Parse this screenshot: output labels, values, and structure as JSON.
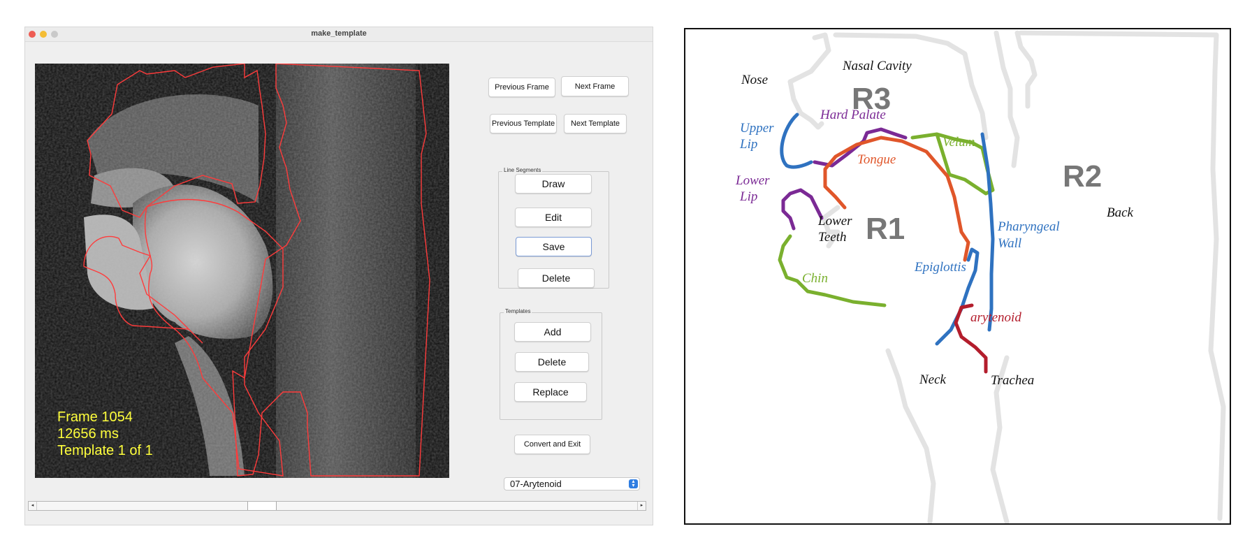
{
  "window": {
    "title": "make_template",
    "traffic_lights": [
      "#ee5c53",
      "#f4bd35",
      "#c9c9c9"
    ]
  },
  "overlay": {
    "frame": "Frame 1054",
    "time": "12656 ms",
    "template": "Template 1 of 1",
    "color": "#ffff3c"
  },
  "buttons": {
    "previous_frame": "Previous Frame",
    "next_frame": "Next Frame",
    "previous_template": "Previous Template",
    "next_template": "Next Template",
    "convert_exit": "Convert and Exit"
  },
  "line_segments": {
    "label": "Line Segments",
    "draw": "Draw",
    "edit": "Edit",
    "save": "Save",
    "delete": "Delete"
  },
  "templates": {
    "label": "Templates",
    "add": "Add",
    "delete": "Delete",
    "replace": "Replace"
  },
  "dropdown": {
    "selected": "07-Arytenoid",
    "icon": "updown-chevron-icon"
  },
  "scrollbar": {
    "left_arrow": "◂",
    "right_arrow": "▸"
  },
  "diagram": {
    "regions": [
      "R1",
      "R2",
      "R3"
    ],
    "labels": {
      "nasal_cavity": "Nasal Cavity",
      "nose": "Nose",
      "hard_palate": "Hard Palate",
      "upper_lip_1": "Upper",
      "upper_lip_2": "Lip",
      "velum": "Velum",
      "tongue": "Tongue",
      "lower_lip_1": "Lower",
      "lower_lip_2": "Lip",
      "lower_teeth_1": "Lower",
      "lower_teeth_2": "Teeth",
      "pharyngeal_1": "Pharyngeal",
      "pharyngeal_2": "Wall",
      "back": "Back",
      "epiglottis": "Epiglottis",
      "chin": "Chin",
      "arytenoid": "arytenoid",
      "neck": "Neck",
      "trachea": "Trachea"
    },
    "colors": {
      "blue": "#2f72c0",
      "purple": "#7b2a95",
      "green": "#7ab02e",
      "orange": "#e0562a",
      "red": "#b31d2c",
      "gray": "#e3e3e3"
    }
  }
}
